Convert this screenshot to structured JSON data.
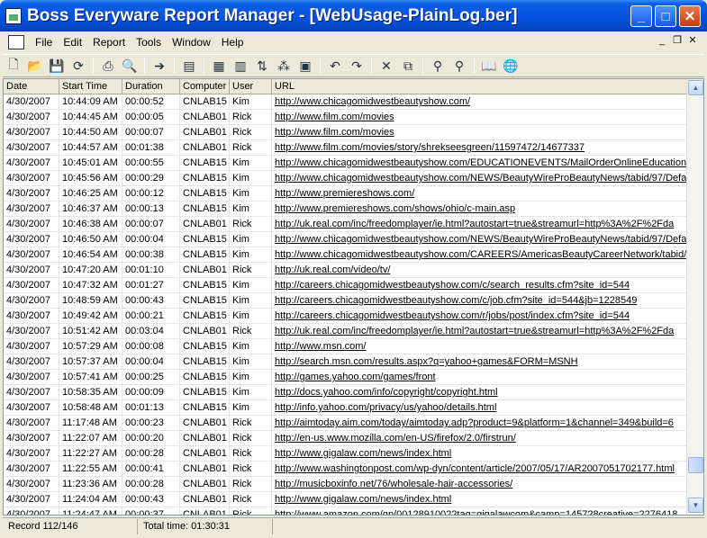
{
  "window": {
    "title": "Boss Everyware Report Manager - [WebUsage-PlainLog.ber]"
  },
  "menu": [
    "File",
    "Edit",
    "Report",
    "Tools",
    "Window",
    "Help"
  ],
  "toolbar_icons": [
    "new-icon",
    "open-icon",
    "save-icon",
    "refresh-icon",
    "print-icon",
    "print-preview-icon",
    "export-icon",
    "report-icon",
    "table-icon",
    "columns-icon",
    "sort-icon",
    "filter-icon",
    "group-icon",
    "undo-icon",
    "redo-icon",
    "delete-icon",
    "copy-icon",
    "find-icon",
    "find-next-icon",
    "help-book-icon",
    "web-icon"
  ],
  "columns": [
    "Date",
    "Start Time",
    "Duration",
    "Computer",
    "User",
    "URL"
  ],
  "rows": [
    [
      "4/30/2007",
      "10:44:09 AM",
      "00:00:52",
      "CNLAB15",
      "Kim",
      "http://www.chicagomidwestbeautyshow.com/"
    ],
    [
      "4/30/2007",
      "10:44:45 AM",
      "00:00:05",
      "CNLAB01",
      "Rick",
      "http://www.film.com/movies"
    ],
    [
      "4/30/2007",
      "10:44:50 AM",
      "00:00:07",
      "CNLAB01",
      "Rick",
      "http://www.film.com/movies"
    ],
    [
      "4/30/2007",
      "10:44:57 AM",
      "00:01:38",
      "CNLAB01",
      "Rick",
      "http://www.film.com/movies/story/shrekseesgreen/11597472/14677337"
    ],
    [
      "4/30/2007",
      "10:45:01 AM",
      "00:00:55",
      "CNLAB15",
      "Kim",
      "http://www.chicagomidwestbeautyshow.com/EDUCATIONEVENTS/MailOrderOnlineEducation/t"
    ],
    [
      "4/30/2007",
      "10:45:56 AM",
      "00:00:29",
      "CNLAB15",
      "Kim",
      "http://www.chicagomidwestbeautyshow.com/NEWS/BeautyWireProBeautyNews/tabid/97/Defa"
    ],
    [
      "4/30/2007",
      "10:46:25 AM",
      "00:00:12",
      "CNLAB15",
      "Kim",
      "http://www.premiereshows.com/"
    ],
    [
      "4/30/2007",
      "10:46:37 AM",
      "00:00:13",
      "CNLAB15",
      "Kim",
      "http://www.premiereshows.com/shows/ohio/c-main.asp"
    ],
    [
      "4/30/2007",
      "10:46:38 AM",
      "00:00:07",
      "CNLAB01",
      "Rick",
      "http://uk.real.com/inc/freedomplayer/ie.html?autostart=true&streamurl=http%3A%2F%2Fda"
    ],
    [
      "4/30/2007",
      "10:46:50 AM",
      "00:00:04",
      "CNLAB15",
      "Kim",
      "http://www.chicagomidwestbeautyshow.com/NEWS/BeautyWireProBeautyNews/tabid/97/Defa"
    ],
    [
      "4/30/2007",
      "10:46:54 AM",
      "00:00:38",
      "CNLAB15",
      "Kim",
      "http://www.chicagomidwestbeautyshow.com/CAREERS/AmericasBeautyCareerNetwork/tabid/"
    ],
    [
      "4/30/2007",
      "10:47:20 AM",
      "00:01:10",
      "CNLAB01",
      "Rick",
      "http://uk.real.com/video/tv/"
    ],
    [
      "4/30/2007",
      "10:47:32 AM",
      "00:01:27",
      "CNLAB15",
      "Kim",
      "http://careers.chicagomidwestbeautyshow.com/c/search_results.cfm?site_id=544"
    ],
    [
      "4/30/2007",
      "10:48:59 AM",
      "00:00:43",
      "CNLAB15",
      "Kim",
      "http://careers.chicagomidwestbeautyshow.com/c/job.cfm?site_id=544&jb=1228549"
    ],
    [
      "4/30/2007",
      "10:49:42 AM",
      "00:00:21",
      "CNLAB15",
      "Kim",
      "http://careers.chicagomidwestbeautyshow.com/r/jobs/post/index.cfm?site_id=544"
    ],
    [
      "4/30/2007",
      "10:51:42 AM",
      "00:03:04",
      "CNLAB01",
      "Rick",
      "http://uk.real.com/inc/freedomplayer/ie.html?autostart=true&streamurl=http%3A%2F%2Fda"
    ],
    [
      "4/30/2007",
      "10:57:29 AM",
      "00:00:08",
      "CNLAB15",
      "Kim",
      "http://www.msn.com/"
    ],
    [
      "4/30/2007",
      "10:57:37 AM",
      "00:00:04",
      "CNLAB15",
      "Kim",
      "http://search.msn.com/results.aspx?q=yahoo+games&FORM=MSNH"
    ],
    [
      "4/30/2007",
      "10:57:41 AM",
      "00:00:25",
      "CNLAB15",
      "Kim",
      "http://games.yahoo.com/games/front"
    ],
    [
      "4/30/2007",
      "10:58:35 AM",
      "00:00:09",
      "CNLAB15",
      "Kim",
      "http://docs.yahoo.com/info/copyright/copyright.html"
    ],
    [
      "4/30/2007",
      "10:58:48 AM",
      "00:01:13",
      "CNLAB15",
      "Kim",
      "http://info.yahoo.com/privacy/us/yahoo/details.html"
    ],
    [
      "4/30/2007",
      "11:17:48 AM",
      "00:00:23",
      "CNLAB01",
      "Rick",
      "http://aimtoday.aim.com/today/aimtoday.adp?product=9&platform=1&channel=349&build=6"
    ],
    [
      "4/30/2007",
      "11:22:07 AM",
      "00:00:20",
      "CNLAB01",
      "Rick",
      "http://en-us.www.mozilla.com/en-US/firefox/2.0/firstrun/"
    ],
    [
      "4/30/2007",
      "11:22:27 AM",
      "00:00:28",
      "CNLAB01",
      "Rick",
      "http://www.gigalaw.com/news/index.html"
    ],
    [
      "4/30/2007",
      "11:22:55 AM",
      "00:00:41",
      "CNLAB01",
      "Rick",
      "http://www.washingtonpost.com/wp-dyn/content/article/2007/05/17/AR2007051702177.html"
    ],
    [
      "4/30/2007",
      "11:23:36 AM",
      "00:00:28",
      "CNLAB01",
      "Rick",
      "http://musicboxinfo.net/76/wholesale-hair-accessories/"
    ],
    [
      "4/30/2007",
      "11:24:04 AM",
      "00:00:43",
      "CNLAB01",
      "Rick",
      "http://www.gigalaw.com/news/index.html"
    ],
    [
      "4/30/2007",
      "11:24:47 AM",
      "00:00:37",
      "CNLAB01",
      "Rick",
      "http://www.amazon.com/gp/00128910022tag=gigalawcom&camp=145728creative=2276418"
    ]
  ],
  "status": {
    "record": "Record 112/146",
    "total_time": "Total time: 01:30:31"
  }
}
